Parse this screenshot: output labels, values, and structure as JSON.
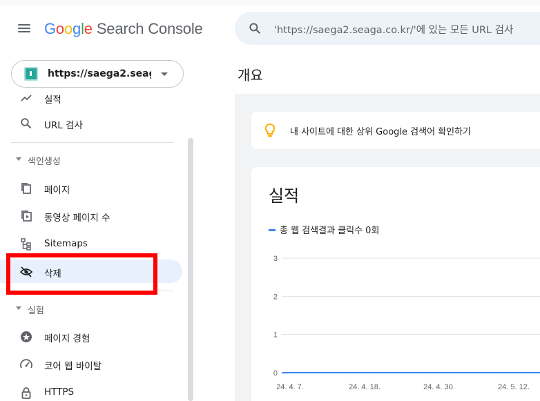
{
  "header": {
    "logo_letters": [
      {
        "ch": "G",
        "cls": "g-blue"
      },
      {
        "ch": "o",
        "cls": "g-red"
      },
      {
        "ch": "o",
        "cls": "g-yellow"
      },
      {
        "ch": "g",
        "cls": "g-blue"
      },
      {
        "ch": "l",
        "cls": "g-green"
      },
      {
        "ch": "e",
        "cls": "g-red"
      }
    ],
    "product": "Search Console",
    "search_placeholder": "'https://saega2.seaga.co.kr/'에 있는 모든 URL 검사"
  },
  "property": {
    "name": "https://saega2.seag..."
  },
  "sidebar": {
    "items_top": [
      {
        "label": "실적",
        "icon": "trending-up-icon"
      },
      {
        "label": "URL 검사",
        "icon": "search-icon"
      }
    ],
    "section_indexing": {
      "label": "색인생성",
      "items": [
        {
          "label": "페이지",
          "icon": "pages-icon"
        },
        {
          "label": "동영상 페이지 수",
          "icon": "video-pages-icon"
        },
        {
          "label": "Sitemaps",
          "icon": "sitemap-icon"
        },
        {
          "label": "삭제",
          "icon": "eye-off-icon",
          "active": true
        }
      ]
    },
    "section_experience": {
      "label": "실험",
      "items": [
        {
          "label": "페이지 경험",
          "icon": "page-experience-icon"
        },
        {
          "label": "코어 웹 바이탈",
          "icon": "speedometer-icon"
        },
        {
          "label": "HTTPS",
          "icon": "lock-icon"
        }
      ]
    }
  },
  "main": {
    "title": "개요",
    "tip": "내 사이트에 대한 상위 Google 검색어 확인하기",
    "performance": {
      "title": "실적",
      "legend": "총 웹 검색결과 클릭수 0회"
    }
  },
  "colors": {
    "accent": "#4285f4",
    "highlight": "#ff0000",
    "active_bg": "#e8f0fe"
  },
  "chart_data": {
    "type": "line",
    "x_tick_labels": [
      "24. 4. 7.",
      "24. 4. 18.",
      "24. 4. 30.",
      "24. 5. 12."
    ],
    "y_ticks": [
      0,
      1,
      2,
      3
    ],
    "ylim": [
      0,
      3
    ],
    "series": [
      {
        "values": [
          0,
          0,
          0,
          0
        ],
        "color": "#4285f4"
      }
    ]
  }
}
